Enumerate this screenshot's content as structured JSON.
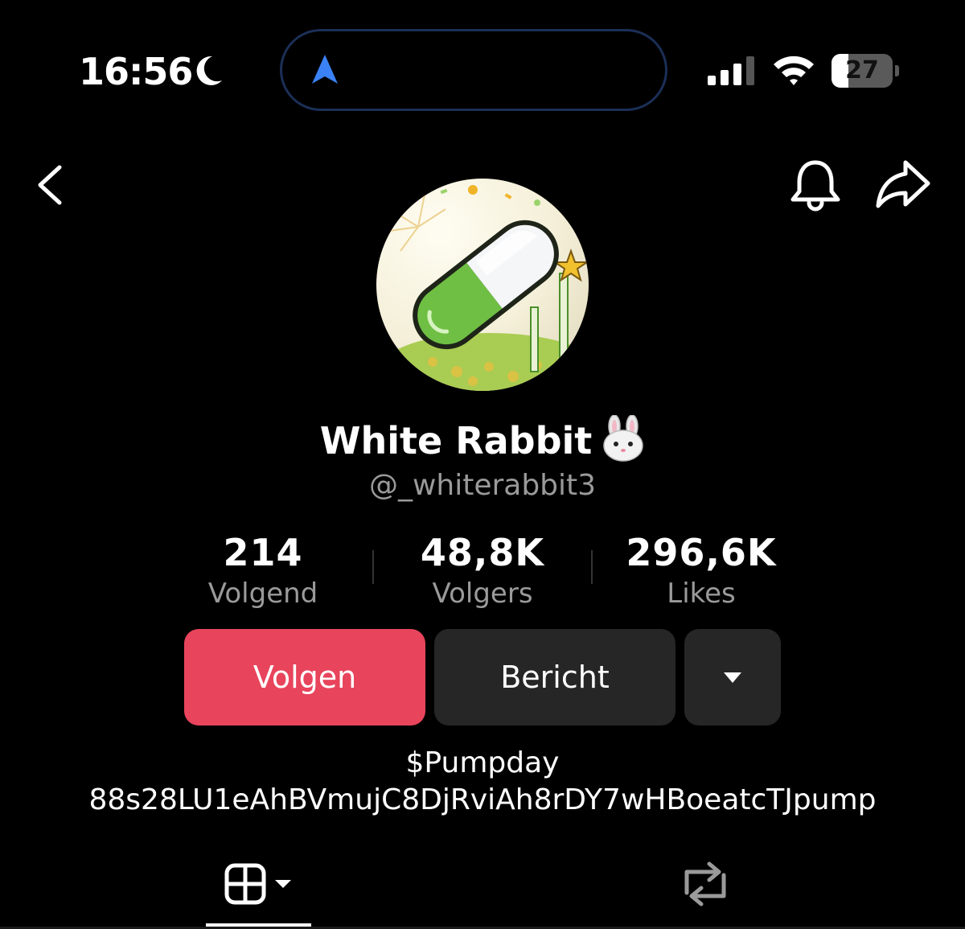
{
  "status_bar": {
    "time": "16:56",
    "focus_icon": "moon-icon",
    "island_icon": "navigation-arrow-icon",
    "signal_icon": "cellular-signal-icon",
    "wifi_icon": "wifi-icon",
    "battery_level": "27",
    "battery_fraction": 0.27
  },
  "header": {
    "back_icon": "chevron-left-icon",
    "bell_icon": "bell-icon",
    "share_icon": "share-icon"
  },
  "profile": {
    "display_name": "White Rabbit",
    "name_emoji_icon": "rabbit-face-icon",
    "handle": "@_whiterabbit3",
    "avatar_icon": "pill-capsule-avatar"
  },
  "stats": [
    {
      "value": "214",
      "label": "Volgend"
    },
    {
      "value": "48,8K",
      "label": "Volgers"
    },
    {
      "value": "296,6K",
      "label": "Likes"
    }
  ],
  "actions": {
    "follow_label": "Volgen",
    "message_label": "Bericht",
    "more_icon": "caret-down-icon"
  },
  "bio": {
    "line1": "$Pumpday",
    "line2": "88s28LU1eAhBVmujC8DjRviAh8rDY7wHBoeatcTJpump"
  },
  "tabs": {
    "videos_icon": "grid-icon",
    "reposts_icon": "repost-icon"
  },
  "colors": {
    "background": "#000000",
    "follow_button": "#e8445c",
    "secondary_button": "#262626",
    "muted_text": "#9a9a9a",
    "island_border": "#1b2f57",
    "nav_arrow": "#3b82f6"
  }
}
